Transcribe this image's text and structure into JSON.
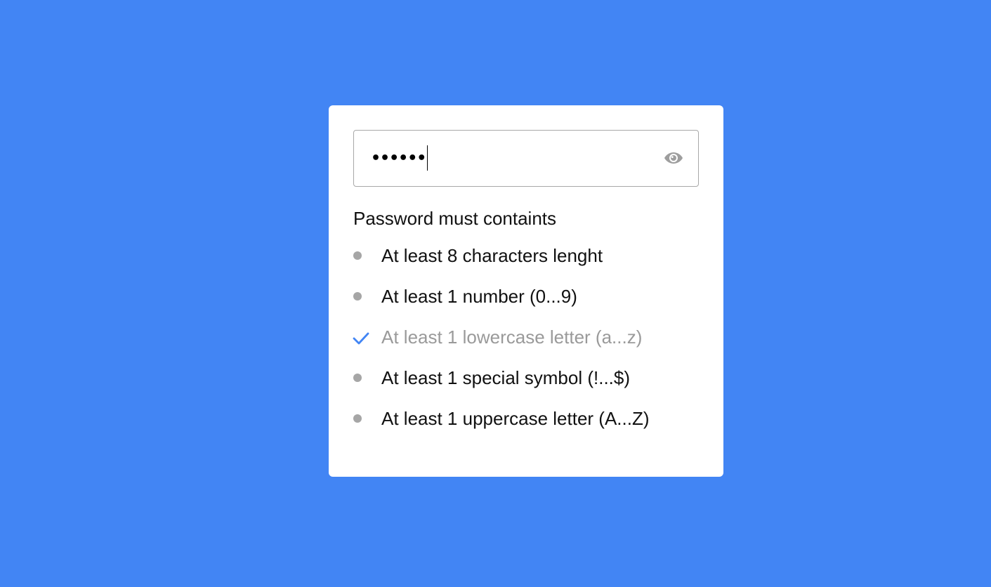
{
  "colors": {
    "background": "#4285f4",
    "card": "#ffffff",
    "check": "#4285f4",
    "bullet": "#a6a6a6",
    "met_text": "#9a9a9a"
  },
  "password_field": {
    "masked_value": "••••••",
    "toggle_icon": "eye-icon"
  },
  "heading": "Password must containts",
  "requirements": [
    {
      "label": "At least 8 characters lenght",
      "met": false
    },
    {
      "label": "At least 1 number (0...9)",
      "met": false
    },
    {
      "label": "At least 1 lowercase letter (a...z)",
      "met": true
    },
    {
      "label": "At least 1 special symbol (!...$)",
      "met": false
    },
    {
      "label": "At least 1 uppercase letter (A...Z)",
      "met": false
    }
  ]
}
